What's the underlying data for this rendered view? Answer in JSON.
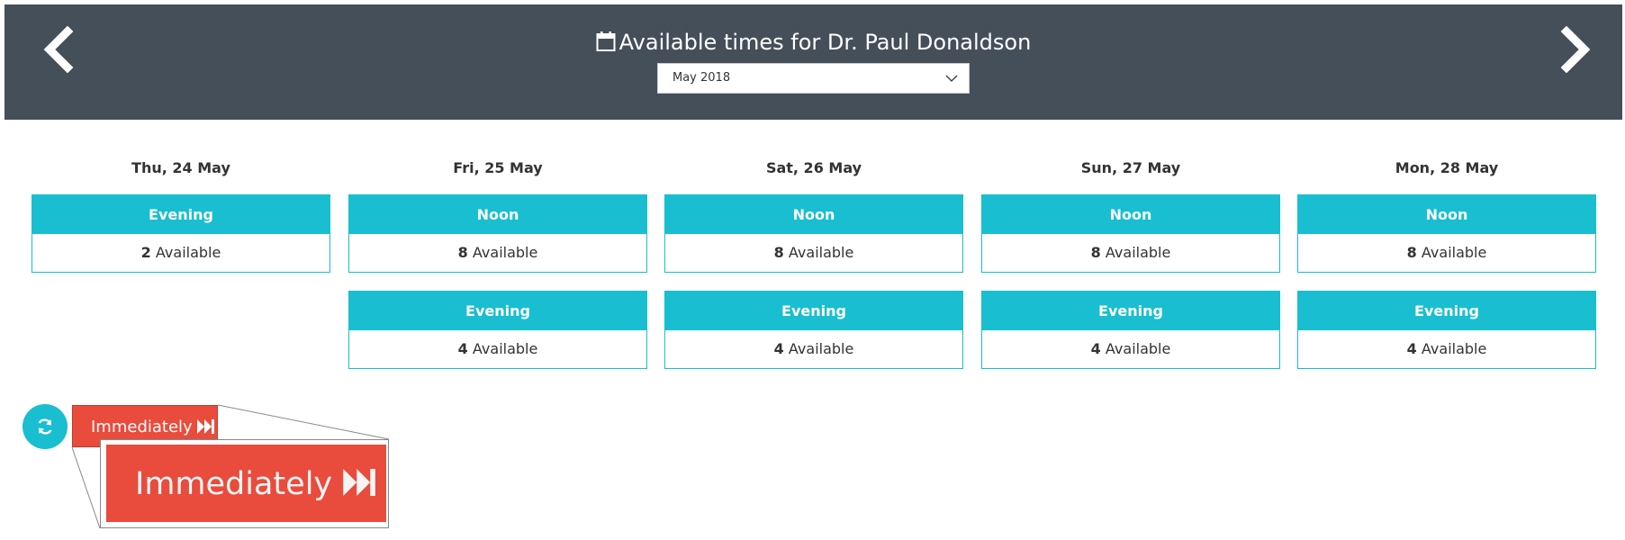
{
  "header": {
    "title": "Available times for Dr. Paul Donaldson",
    "month_select": "May 2018",
    "prev_icon": "chevron-left-icon",
    "next_icon": "chevron-right-icon",
    "background": "#454f5a"
  },
  "days": [
    {
      "label": "Thu, 24 May",
      "slots": [
        {
          "period": "Evening",
          "count": "2",
          "suffix": "Available"
        }
      ]
    },
    {
      "label": "Fri, 25 May",
      "slots": [
        {
          "period": "Noon",
          "count": "8",
          "suffix": "Available"
        },
        {
          "period": "Evening",
          "count": "4",
          "suffix": "Available"
        }
      ]
    },
    {
      "label": "Sat, 26 May",
      "slots": [
        {
          "period": "Noon",
          "count": "8",
          "suffix": "Available"
        },
        {
          "period": "Evening",
          "count": "4",
          "suffix": "Available"
        }
      ]
    },
    {
      "label": "Sun, 27 May",
      "slots": [
        {
          "period": "Noon",
          "count": "8",
          "suffix": "Available"
        },
        {
          "period": "Evening",
          "count": "4",
          "suffix": "Available"
        }
      ]
    },
    {
      "label": "Mon, 28 May",
      "slots": [
        {
          "period": "Noon",
          "count": "8",
          "suffix": "Available"
        },
        {
          "period": "Evening",
          "count": "4",
          "suffix": "Available"
        }
      ]
    }
  ],
  "footer": {
    "refresh_icon": "refresh-icon",
    "immediately_label": "Immediately",
    "immediately_icon": "fast-forward-icon"
  },
  "colors": {
    "accent": "#19bed0",
    "immediate": "#e94b3c"
  }
}
